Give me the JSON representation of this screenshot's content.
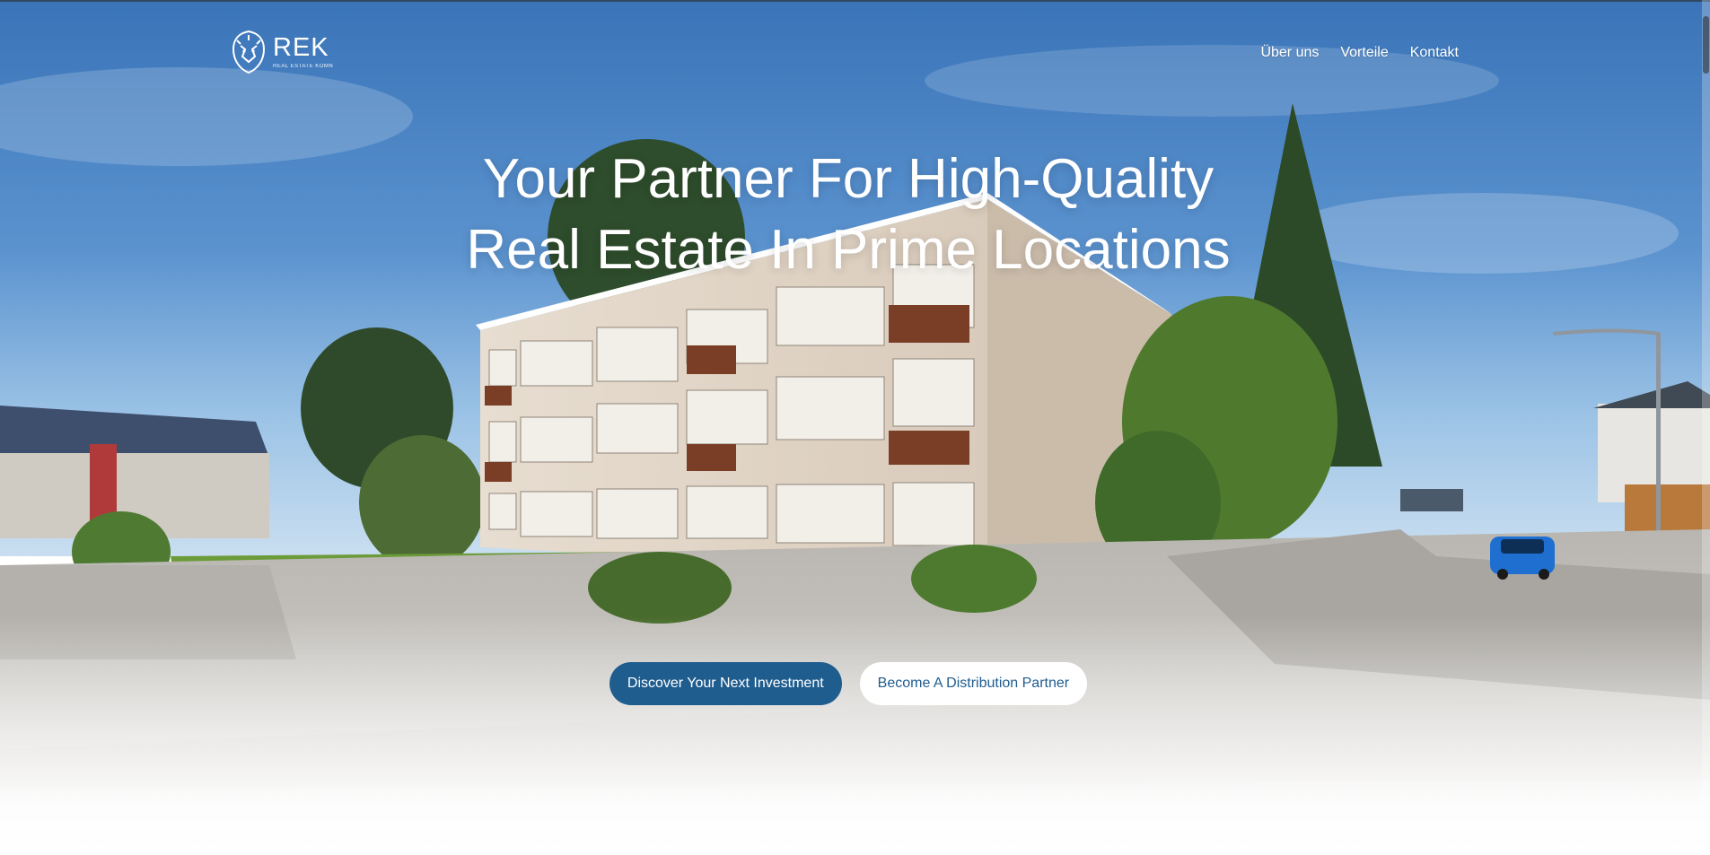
{
  "brand": {
    "name": "REK",
    "tagline": "REAL ESTATE KOMN",
    "logo_icon": "lion-head-icon"
  },
  "nav": {
    "items": [
      {
        "label": "Über uns"
      },
      {
        "label": "Vorteile"
      },
      {
        "label": "Kontakt"
      }
    ]
  },
  "hero": {
    "headline_line1": "Your Partner For High-Quality",
    "headline_line2": "Real Estate In Prime Locations",
    "primary_cta": "Discover Your Next Investment",
    "secondary_cta": "Become A Distribution Partner"
  },
  "colors": {
    "accent": "#1f5d8f",
    "sky": "#3f7fc6",
    "text_on_hero": "#ffffff"
  }
}
